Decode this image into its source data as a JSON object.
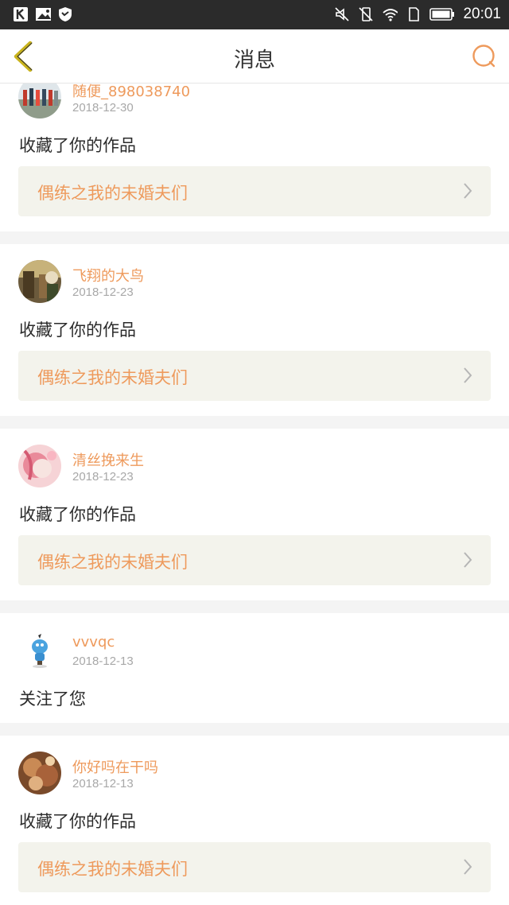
{
  "status_bar": {
    "time": "20:01"
  },
  "header": {
    "title": "消息"
  },
  "messages": [
    {
      "username": "随便_898038740",
      "date": "2018-12-30",
      "action": "收藏了你的作品",
      "work_title": "偶练之我的未婚夫们"
    },
    {
      "username": "飞翔的大鸟",
      "date": "2018-12-23",
      "action": "收藏了你的作品",
      "work_title": "偶练之我的未婚夫们"
    },
    {
      "username": "清丝挽来生",
      "date": "2018-12-23",
      "action": "收藏了你的作品",
      "work_title": "偶练之我的未婚夫们"
    },
    {
      "username": "vvvqc",
      "date": "2018-12-13",
      "action": "关注了您"
    },
    {
      "username": "你好吗在干吗",
      "date": "2018-12-13",
      "action": "收藏了你的作品",
      "work_title": "偶练之我的未婚夫们"
    }
  ],
  "colors": {
    "accent": "#ee9a5c",
    "back_arrow": "#c9b31c",
    "work_bg": "#f3f3ec"
  }
}
